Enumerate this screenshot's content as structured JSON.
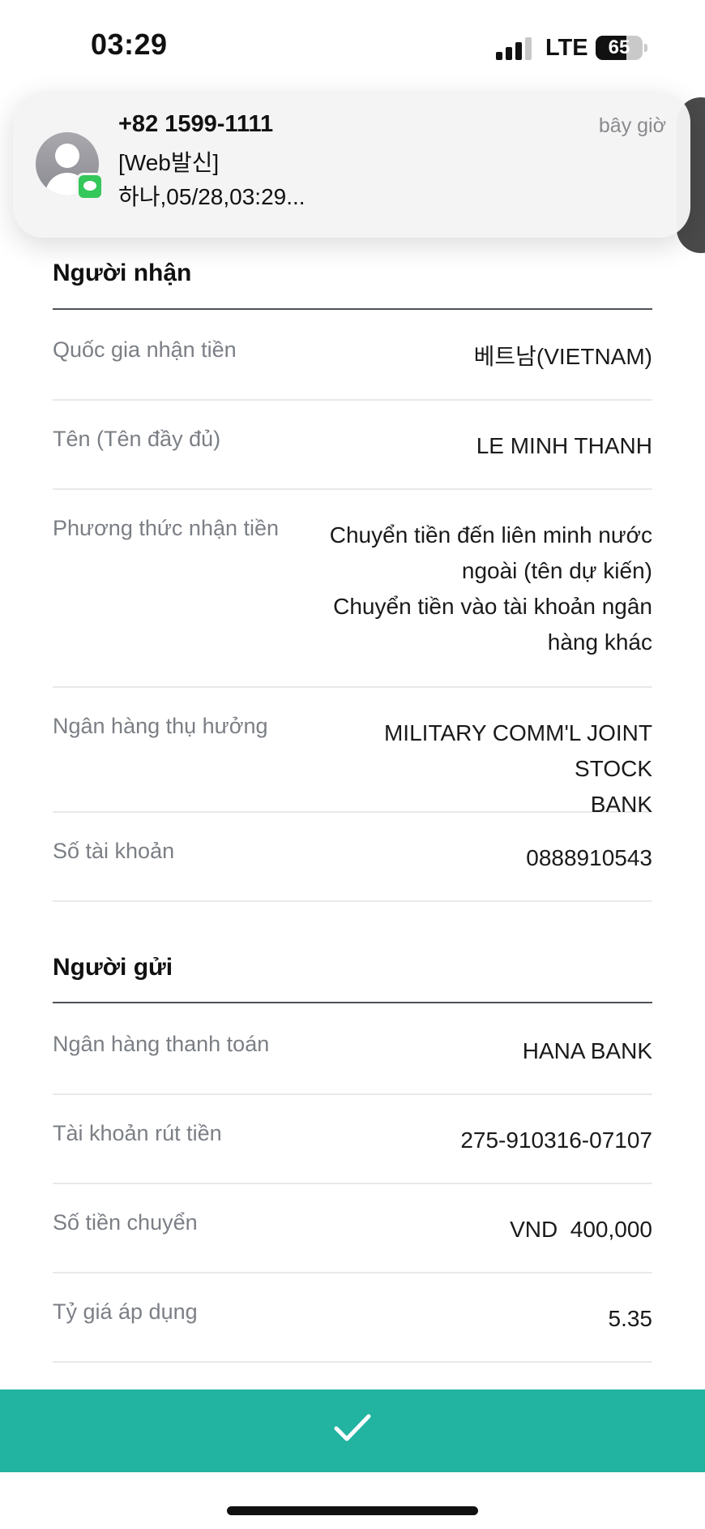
{
  "status_bar": {
    "time": "03:29",
    "network": "LTE",
    "battery": "65",
    "battery_fraction": 0.65
  },
  "notification": {
    "sender": "+82 1599-1111",
    "title": "[Web발신]",
    "body": "하나,05/28,03:29...",
    "time": "bây giờ",
    "app_icon": "messages-icon"
  },
  "recipient": {
    "section_title": "Người nhận",
    "rows": [
      {
        "label": "Quốc gia nhận tiền",
        "value": "베트남(VIETNAM)"
      },
      {
        "label": "Tên (Tên đầy đủ)",
        "value": "LE MINH THANH"
      },
      {
        "label": "Phương thức nhận tiền",
        "value_lines": [
          "Chuyển tiền đến liên minh nước",
          "ngoài (tên dự kiến)",
          "Chuyển tiền vào tài khoản ngân",
          "hàng khác"
        ]
      },
      {
        "label": "Ngân hàng thụ hưởng",
        "value_lines": [
          "MILITARY COMM'L JOINT STOCK",
          "BANK"
        ]
      },
      {
        "label": "Số tài khoản",
        "value": "0888910543"
      }
    ]
  },
  "sender": {
    "section_title": "Người gửi",
    "rows": [
      {
        "label": "Ngân hàng thanh toán",
        "value": "HANA BANK"
      },
      {
        "label": "Tài khoản rút tiền",
        "value": "275-910316-07107"
      },
      {
        "label": "Số tiền chuyển",
        "value": "VND  400,000"
      },
      {
        "label": "Tỷ giá áp dụng",
        "value": "5.35"
      }
    ]
  },
  "confirm_button": {
    "icon": "check-icon",
    "color": "#23b3a1"
  }
}
